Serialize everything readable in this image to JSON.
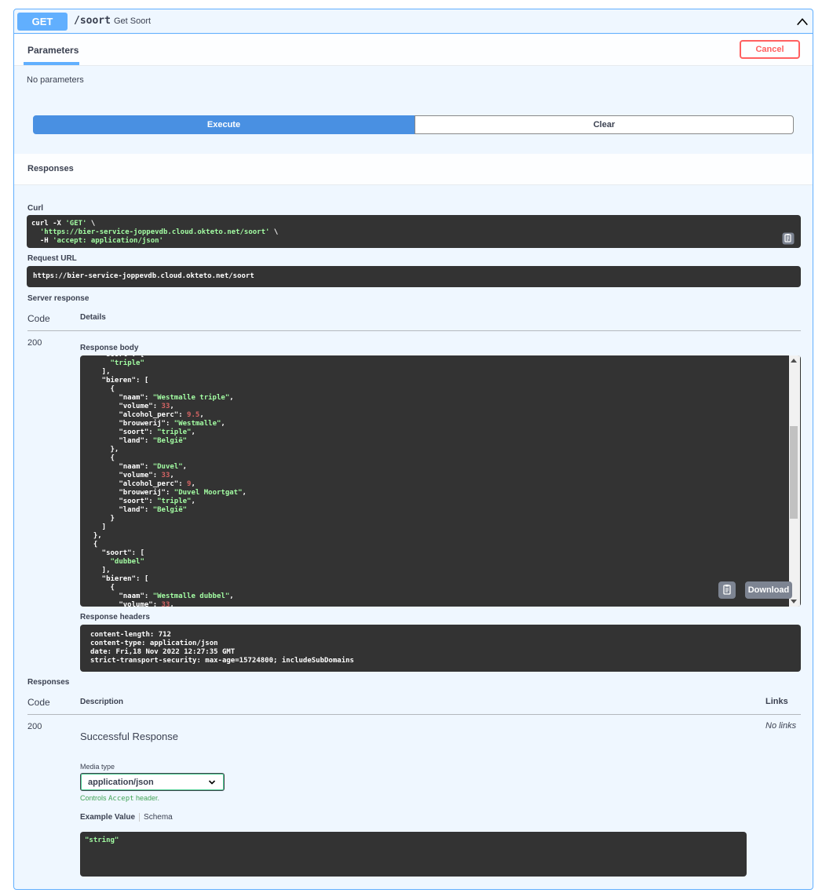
{
  "operation": {
    "method": "GET",
    "path": "/soort",
    "summary": "Get Soort"
  },
  "tabs": {
    "parameters": "Parameters",
    "cancel": "Cancel"
  },
  "parameters": {
    "empty_text": "No parameters"
  },
  "actions": {
    "execute": "Execute",
    "clear": "Clear"
  },
  "responses_title": "Responses",
  "curl": {
    "label": "Curl",
    "line1": "curl -X ",
    "line1_method": "'GET'",
    "line1_tail": " \\",
    "line2_url": "'https://bier-service-joppevdb.cloud.okteto.net/soort'",
    "line2_tail": " \\",
    "line3_flag": "  -H ",
    "line3_value": "'accept: application/json'"
  },
  "request_url": {
    "label": "Request URL",
    "value": "https://bier-service-joppevdb.cloud.okteto.net/soort"
  },
  "server_response": {
    "label": "Server response",
    "col_code": "Code",
    "col_details": "Details",
    "code": "200",
    "body_label": "Response body",
    "download": "Download",
    "headers_label": "Response headers",
    "headers": [
      "content-length: 712",
      "content-type: application/json",
      "date: Fri,18 Nov 2022 12:27:35 GMT",
      "strict-transport-security: max-age=15724800; includeSubDomains"
    ]
  },
  "responses_table": {
    "label": "Responses",
    "col_code": "Code",
    "col_description": "Description",
    "col_links": "Links",
    "code": "200",
    "description": "Successful Response",
    "links": "No links",
    "media_type_label": "Media type",
    "media_type_value": "application/json",
    "controls_prefix": "Controls ",
    "controls_mono": "Accept",
    "controls_suffix": " header.",
    "example_tab": "Example Value",
    "schema_tab": "Schema",
    "example_value": "\"string\""
  },
  "colors": {
    "get_blue": "#61affe",
    "execute_blue": "#4990e2",
    "cancel_red": "#ff6060",
    "code_bg": "#333333",
    "json_string": "#a2fca2",
    "json_number": "#d36363"
  },
  "icons": {
    "collapse": "chevron-up-icon",
    "copy": "clipboard-copy-icon",
    "select": "chevron-down-icon"
  }
}
